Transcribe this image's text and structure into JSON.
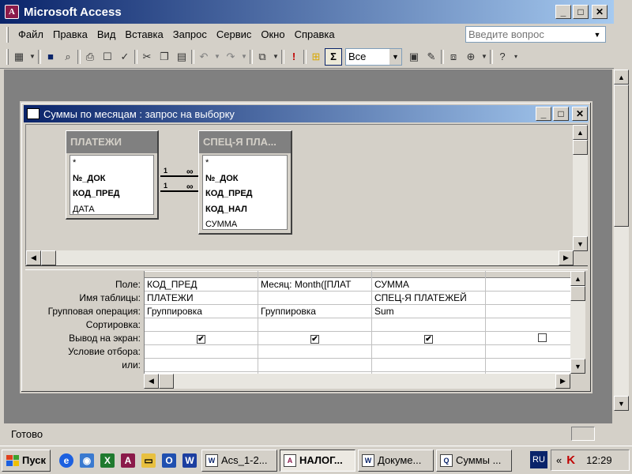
{
  "app": {
    "title": "Microsoft Access"
  },
  "menu": {
    "items": [
      "Файл",
      "Правка",
      "Вид",
      "Вставка",
      "Запрос",
      "Сервис",
      "Окно",
      "Справка"
    ],
    "help_placeholder": "Введите вопрос"
  },
  "toolbar": {
    "top_values": "Все",
    "sigma": "Σ"
  },
  "query_window": {
    "title": "Суммы по месяцам : запрос на выборку",
    "tables": [
      {
        "name": "ПЛАТЕЖИ",
        "fields": [
          {
            "name": "*",
            "key": false
          },
          {
            "name": "№_ДОК",
            "key": true
          },
          {
            "name": "КОД_ПРЕД",
            "key": true
          },
          {
            "name": "ДАТА",
            "key": false
          }
        ]
      },
      {
        "name": "СПЕЦ-Я ПЛА...",
        "fields": [
          {
            "name": "*",
            "key": false
          },
          {
            "name": "№_ДОК",
            "key": true
          },
          {
            "name": "КОД_ПРЕД",
            "key": true
          },
          {
            "name": "КОД_НАЛ",
            "key": true
          },
          {
            "name": "СУММА",
            "key": false
          }
        ]
      }
    ],
    "relations": [
      {
        "one": "1",
        "many": "∞"
      },
      {
        "one": "1",
        "many": "∞"
      }
    ],
    "grid": {
      "row_labels": [
        "Поле:",
        "Имя таблицы:",
        "Групповая операция:",
        "Сортировка:",
        "Вывод на экран:",
        "Условие отбора:",
        "или:"
      ],
      "columns": [
        {
          "field": "КОД_ПРЕД",
          "table": "ПЛАТЕЖИ",
          "total": "Группировка",
          "sort": "",
          "show": "✔"
        },
        {
          "field": "Месяц: Month([ПЛАТ",
          "table": "",
          "total": "Группировка",
          "sort": "",
          "show": "✔"
        },
        {
          "field": "СУММА",
          "table": "СПЕЦ-Я ПЛАТЕЖЕЙ",
          "total": "Sum",
          "sort": "",
          "show": "✔"
        },
        {
          "field": "",
          "table": "",
          "total": "",
          "sort": "",
          "show": ""
        }
      ]
    }
  },
  "status": {
    "text": "Готово"
  },
  "taskbar": {
    "start": "Пуск",
    "tasks": [
      {
        "label": "Acs_1-2...",
        "icon": "W"
      },
      {
        "label": "НАЛОГ...",
        "icon": "A"
      },
      {
        "label": "Докуме...",
        "icon": "W"
      },
      {
        "label": "Суммы ...",
        "icon": "Q"
      }
    ],
    "lang": "RU",
    "tray_chevron": "«",
    "tray_k": "K",
    "clock": "12:29"
  }
}
